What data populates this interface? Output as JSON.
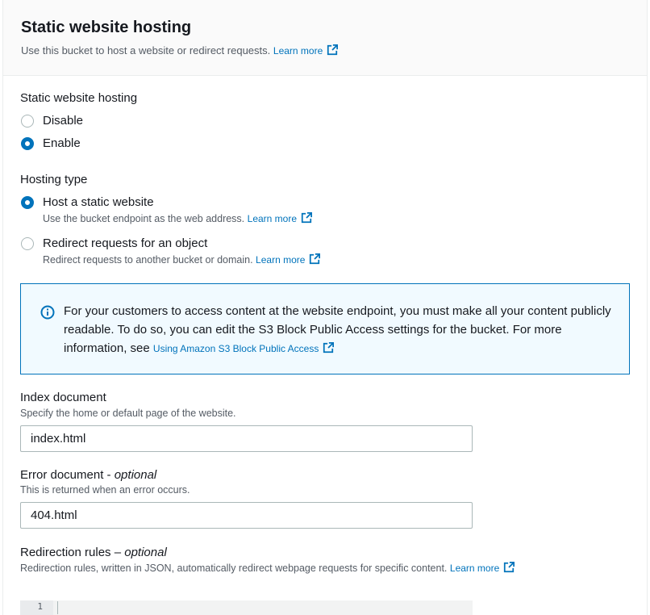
{
  "header": {
    "title": "Static website hosting",
    "description": "Use this bucket to host a website or redirect requests.",
    "learn_more": "Learn more"
  },
  "hosting": {
    "label": "Static website hosting",
    "options": [
      {
        "label": "Disable",
        "checked": false
      },
      {
        "label": "Enable",
        "checked": true
      }
    ]
  },
  "hosting_type": {
    "label": "Hosting type",
    "options": [
      {
        "label": "Host a static website",
        "description": "Use the bucket endpoint as the web address.",
        "learn_more": "Learn more",
        "checked": true
      },
      {
        "label": "Redirect requests for an object",
        "description": "Redirect requests to another bucket or domain.",
        "learn_more": "Learn more",
        "checked": false
      }
    ]
  },
  "info": {
    "text": "For your customers to access content at the website endpoint, you must make all your content publicly readable. To do so, you can edit the S3 Block Public Access settings for the bucket. For more information, see",
    "link": "Using Amazon S3 Block Public Access"
  },
  "index_document": {
    "label": "Index document",
    "description": "Specify the home or default page of the website.",
    "value": "index.html"
  },
  "error_document": {
    "label": "Error document - ",
    "optional": "optional",
    "description": "This is returned when an error occurs.",
    "value": "404.html"
  },
  "redirection_rules": {
    "label": "Redirection rules – ",
    "optional": "optional",
    "description": "Redirection rules, written in JSON, automatically redirect webpage requests for specific content.",
    "learn_more": "Learn more",
    "line_number": "1"
  },
  "colors": {
    "accent": "#0073bb",
    "info_bg": "#f1faff",
    "text": "#16191f",
    "muted": "#545b64"
  }
}
